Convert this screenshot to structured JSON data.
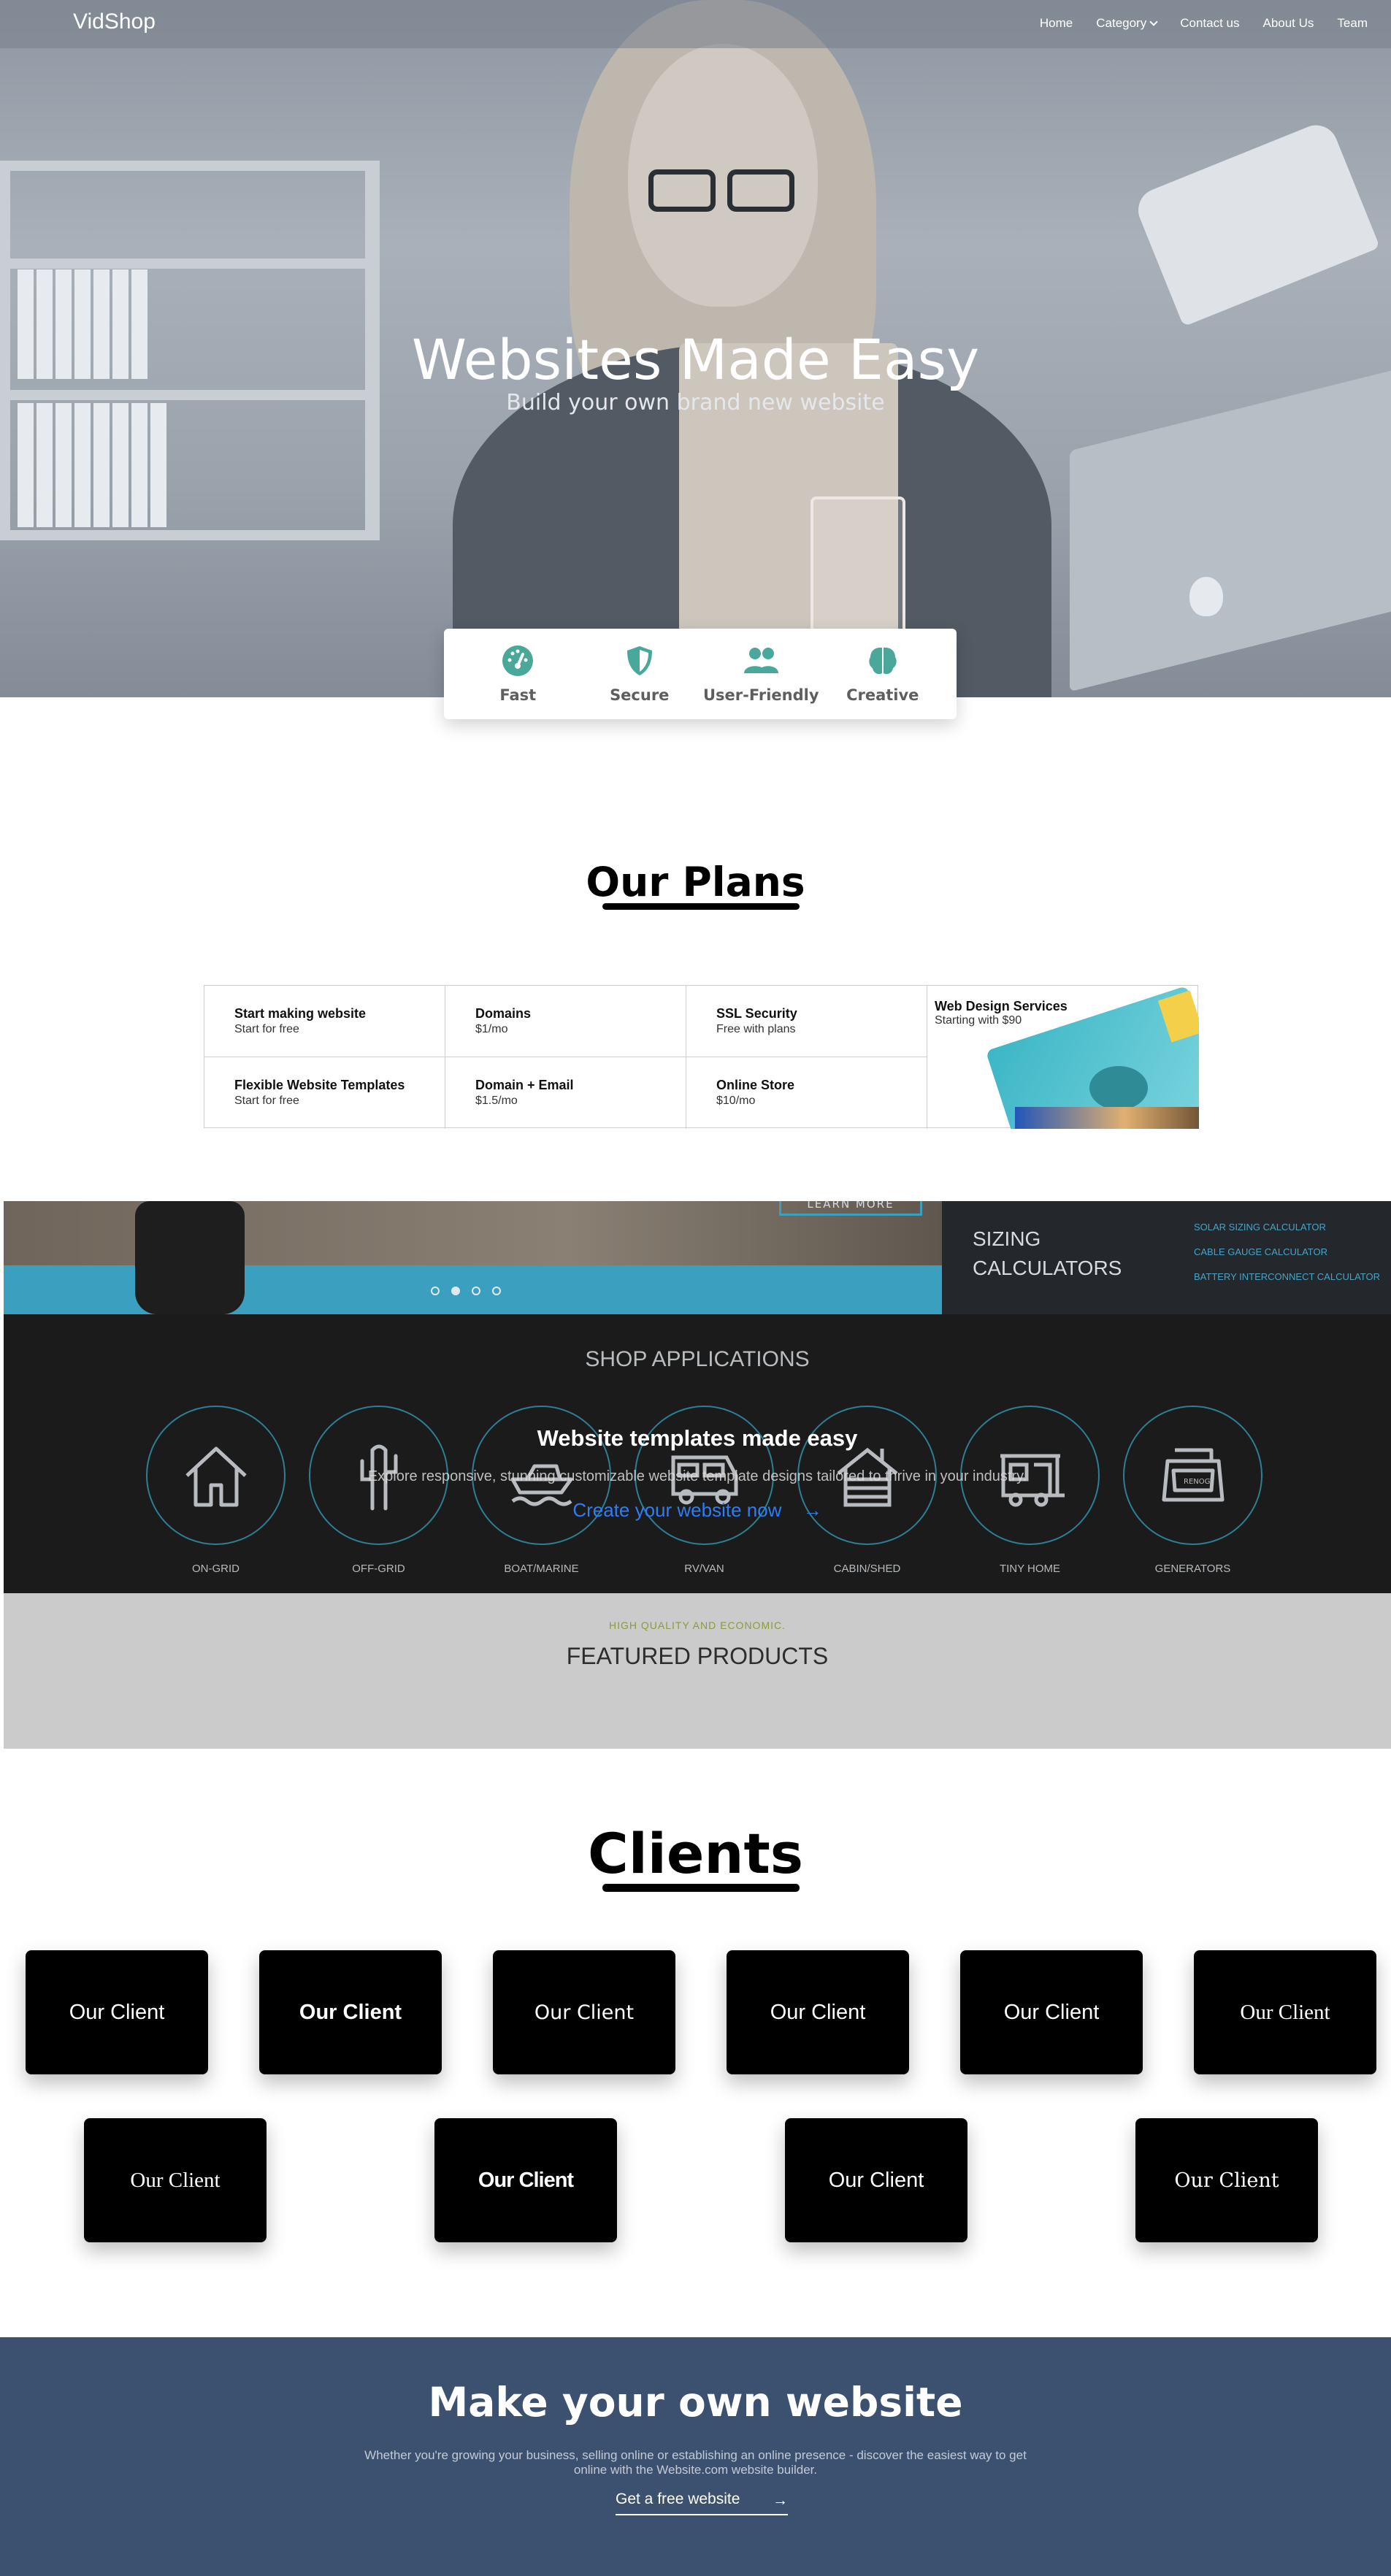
{
  "nav": {
    "brand": "VidShop",
    "links": [
      "Home",
      "Category",
      "Contact us",
      "About Us",
      "Team"
    ]
  },
  "hero": {
    "title": "Websites Made Easy",
    "subtitle": "Build your own brand new website"
  },
  "features": [
    {
      "label": "Fast",
      "icon": "speedometer-icon"
    },
    {
      "label": "Secure",
      "icon": "shield-icon"
    },
    {
      "label": "User-Friendly",
      "icon": "users-icon"
    },
    {
      "label": "Creative",
      "icon": "brain-icon"
    }
  ],
  "plans": {
    "title": "Our Plans",
    "items": [
      {
        "name": "Start making website",
        "price": "Start for free"
      },
      {
        "name": "Domains",
        "price": "$1/mo"
      },
      {
        "name": "SSL Security",
        "price": "Free with plans"
      },
      {
        "name": "Flexible Website Templates",
        "price": "Start for free"
      },
      {
        "name": "Domain + Email",
        "price": "$1.5/mo"
      },
      {
        "name": "Online Store",
        "price": "$10/mo"
      }
    ],
    "promo": {
      "name": "Web Design Services",
      "price": "Starting with $90"
    }
  },
  "store": {
    "banner_button": "LEARN   MORE",
    "sizing_title": "SIZING CALCULATORS",
    "sizing_links": [
      "SOLAR SIZING CALCULATOR",
      "CABLE GAUGE CALCULATOR",
      "BATTERY INTERCONNECT CALCULATOR"
    ],
    "shop_title": "SHOP APPLICATIONS",
    "applications": [
      "ON-GRID",
      "OFF-GRID",
      "BOAT/MARINE",
      "RV/VAN",
      "CABIN/SHED",
      "TINY HOME",
      "GENERATORS"
    ],
    "generator_brand": "RENOGY",
    "overlay_title": "Website templates made easy",
    "overlay_desc": "Explore responsive, stunning customizable website template designs tailored to thrive in your industry.",
    "overlay_link": "Create your website now",
    "featured_kicker": "HIGH QUALITY AND ECONOMIC.",
    "featured_title": "FEATURED PRODUCTS"
  },
  "clients": {
    "title": "Clients",
    "items": [
      "Our Client",
      "Our Client",
      "Our Client",
      "Our Client",
      "Our Client",
      "Our Client",
      "Our Client",
      "Our Client",
      "Our Client",
      "Our Client"
    ]
  },
  "cta": {
    "title": "Make your own website",
    "text": "Whether you're growing your business, selling online or establishing an online presence - discover the easiest way to get online with the Website.com website builder.",
    "button": "Get a free website"
  },
  "colors": {
    "accent_teal": "#4aa89a",
    "cta_bg": "#3c5170",
    "link_blue": "#2e7df6"
  }
}
